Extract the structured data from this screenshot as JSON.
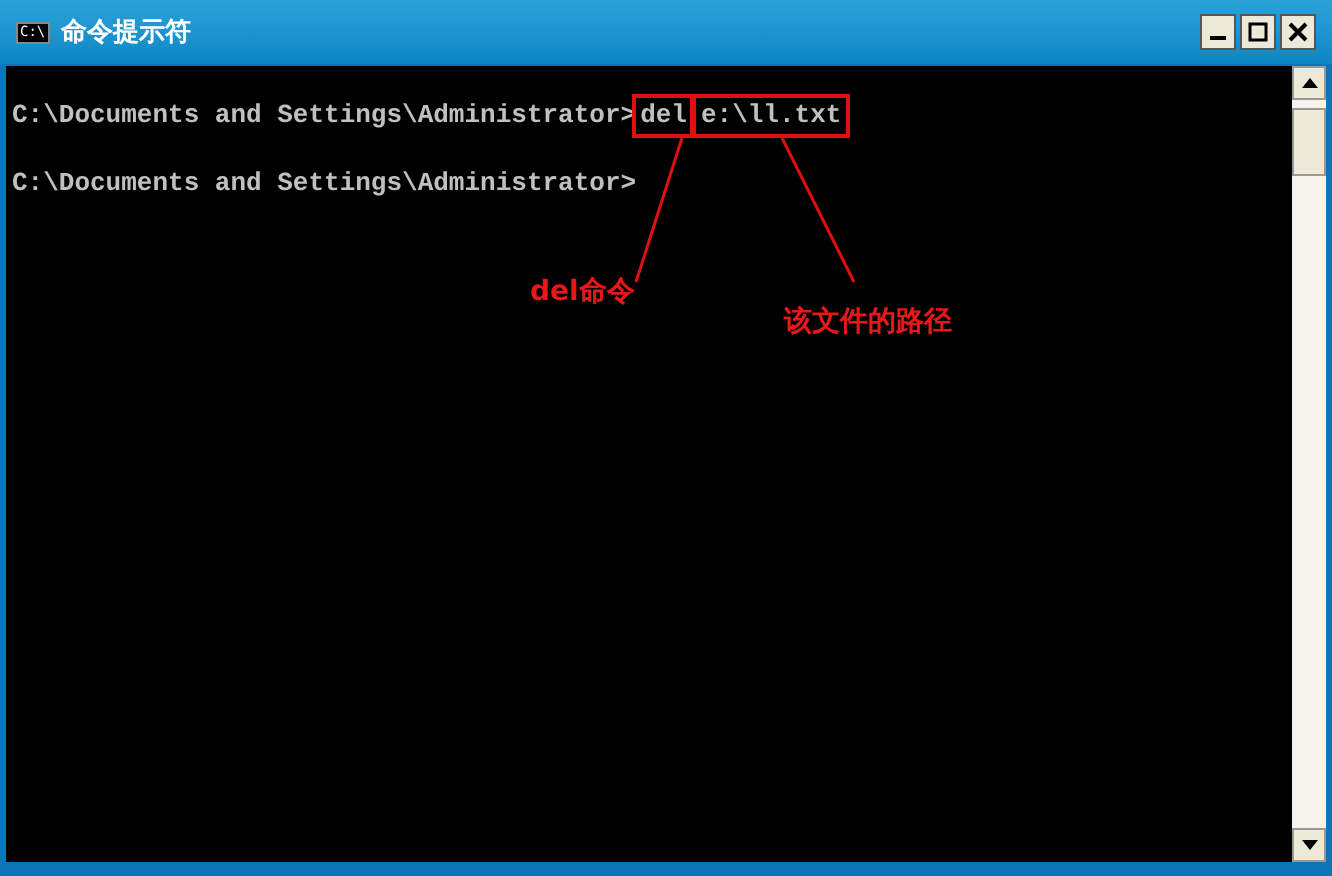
{
  "window": {
    "title": "命令提示符",
    "icon_label": "C:\\"
  },
  "console": {
    "lines": [
      {
        "prompt": "C:\\Documents and Settings\\Administrator>",
        "command": "del",
        "argument": "e:\\ll.txt"
      },
      {
        "prompt": "C:\\Documents and Settings\\Administrator>"
      }
    ]
  },
  "annotations": [
    {
      "kind": "command",
      "text": "del命令"
    },
    {
      "kind": "path",
      "text": "该文件的路径"
    }
  ]
}
